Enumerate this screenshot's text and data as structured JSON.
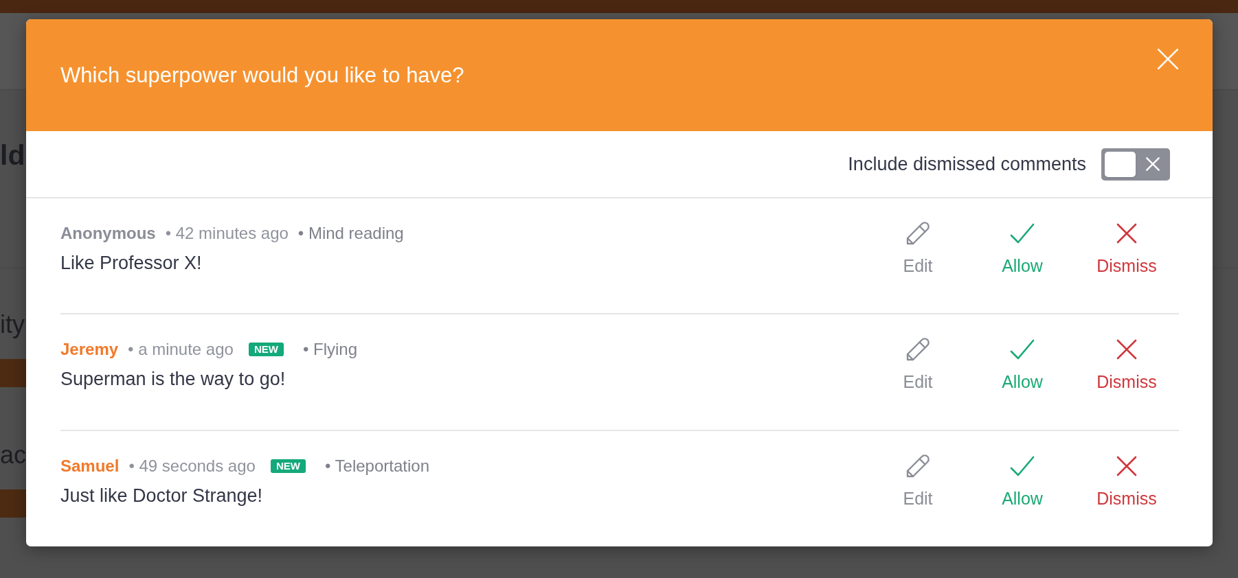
{
  "background_page": {
    "sections": [
      {
        "kind": "heading",
        "text": "ld"
      },
      {
        "kind": "field",
        "text": "ity"
      },
      {
        "kind": "field",
        "text": "ac"
      }
    ]
  },
  "dialog": {
    "title": "Which superpower would you like to have?"
  },
  "filter": {
    "label": "Include dismissed comments",
    "on": false
  },
  "comments": [
    {
      "author": "Anonymous",
      "anonymous": true,
      "time": "• 42 minutes ago",
      "topic": "• Mind reading",
      "text": "Like Professor X!",
      "actions": [
        {
          "kind": "edit",
          "label": "Edit"
        },
        {
          "kind": "allow",
          "label": "Allow"
        },
        {
          "kind": "dismiss",
          "label": "Dismiss"
        }
      ]
    },
    {
      "author": "Jeremy",
      "anonymous": false,
      "time": "• a minute ago",
      "badge": "NEW",
      "topic": "• Flying",
      "text": "Superman is the way to go!",
      "actions": [
        {
          "kind": "edit",
          "label": "Edit"
        },
        {
          "kind": "allow",
          "label": "Allow"
        },
        {
          "kind": "dismiss",
          "label": "Dismiss"
        }
      ]
    },
    {
      "author": "Samuel",
      "anonymous": false,
      "time": "• 49 seconds ago",
      "badge": "NEW",
      "topic": "• Teleportation",
      "text": "Just like Doctor Strange!",
      "actions": [
        {
          "kind": "edit",
          "label": "Edit"
        },
        {
          "kind": "allow",
          "label": "Allow"
        },
        {
          "kind": "dismiss",
          "label": "Dismiss"
        }
      ]
    }
  ]
}
